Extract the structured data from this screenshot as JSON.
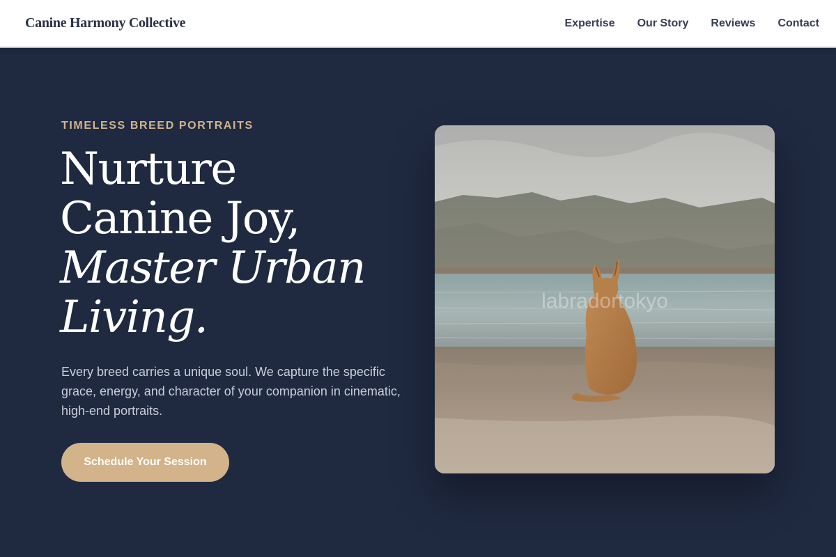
{
  "header": {
    "brand": "Canine Harmony Collective",
    "nav": [
      {
        "label": "Expertise"
      },
      {
        "label": "Our Story"
      },
      {
        "label": "Reviews"
      },
      {
        "label": "Contact"
      }
    ]
  },
  "hero": {
    "eyebrow": "TIMELESS BREED PORTRAITS",
    "headline_line1": "Nurture",
    "headline_line2": "Canine Joy,",
    "headline_line3": "Master Urban",
    "headline_line4": "Living.",
    "description": "Every breed carries a unique soul. We capture the specific grace, energy, and character of your companion in cinematic, high-end portraits.",
    "cta_label": "Schedule Your Session",
    "image_watermark": "labradortokyo"
  },
  "colors": {
    "background": "#1f2940",
    "accent": "#d2b38a",
    "eyebrow": "#d1b58e",
    "nav_text": "#364055"
  }
}
